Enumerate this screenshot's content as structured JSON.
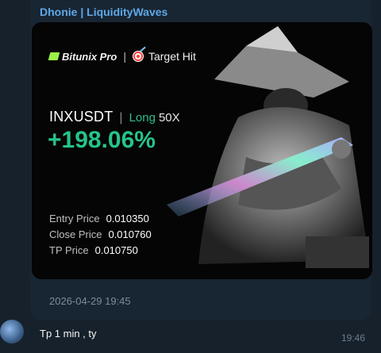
{
  "message": {
    "sender": "Dhonie | LiquidityWaves",
    "timestamp": "2026-04-29 19:45"
  },
  "card": {
    "brand": "Bitunix Pro",
    "separator": "|",
    "status": "Target Hit",
    "pair": "INXUSDT",
    "pair_separator": "|",
    "side": "Long",
    "leverage": "50X",
    "pnl": "+198.06%",
    "prices": [
      {
        "label": "Entry Price",
        "value": "0.010350"
      },
      {
        "label": "Close Price",
        "value": "0.010760"
      },
      {
        "label": "TP Price",
        "value": "0.010750"
      }
    ]
  },
  "reply": {
    "text": "Tp 1 min , ty",
    "time": "19:46"
  },
  "colors": {
    "accent_green": "#25c48a",
    "sender_blue": "#5ea8e6",
    "background": "#17212b"
  }
}
